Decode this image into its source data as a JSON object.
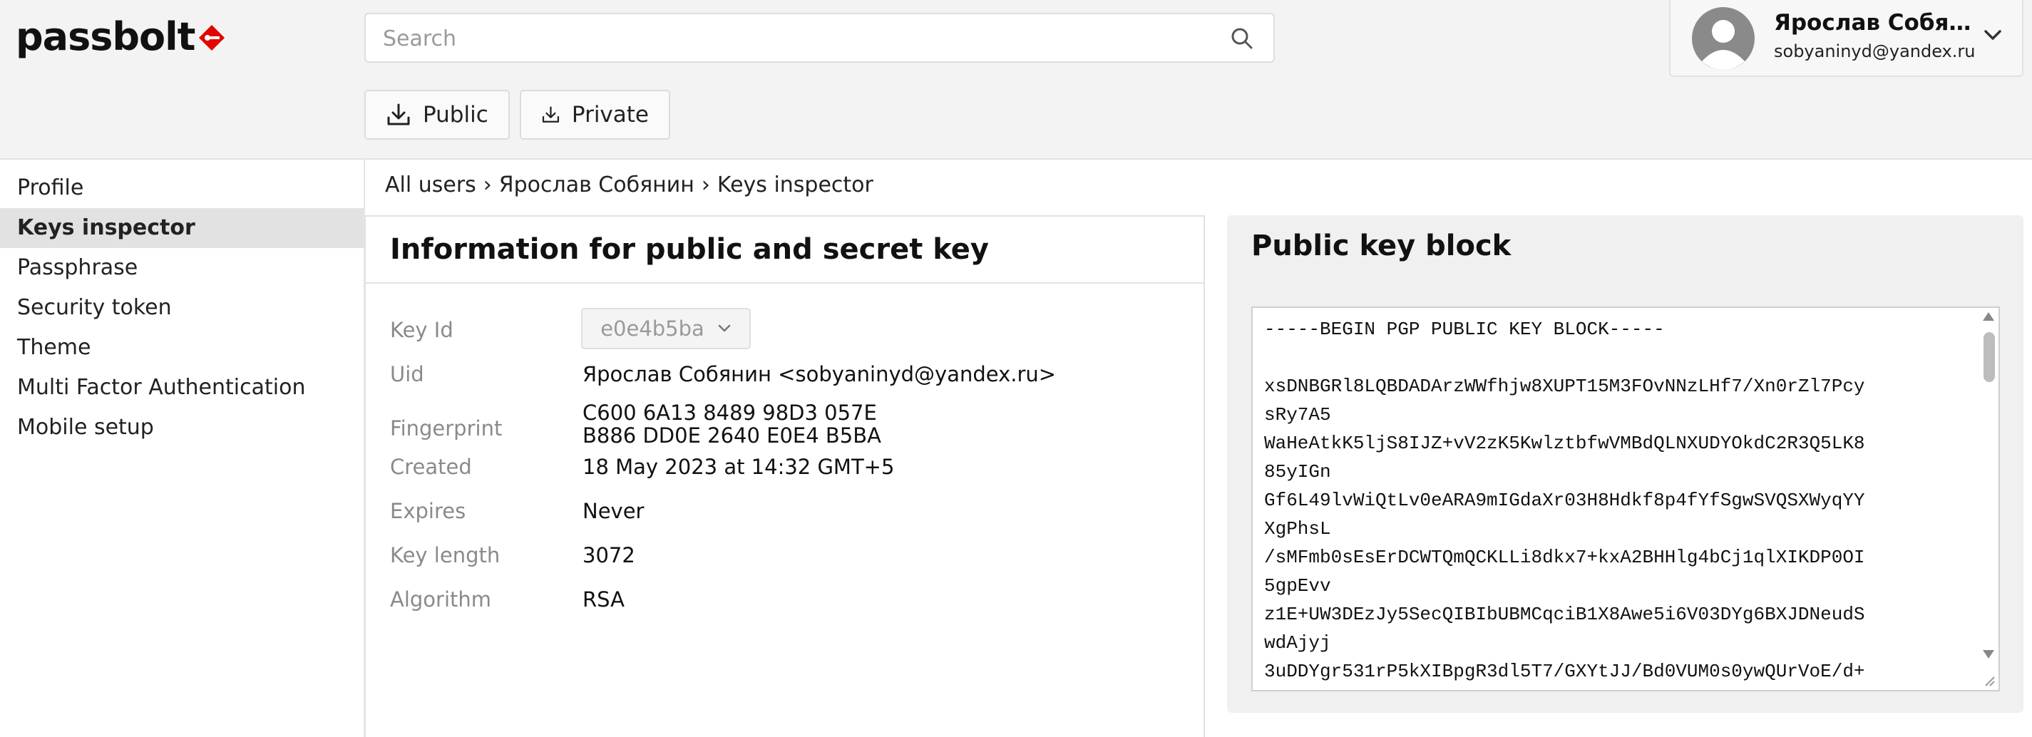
{
  "app": {
    "logo_text": "passbolt"
  },
  "search": {
    "placeholder": "Search",
    "value": ""
  },
  "user": {
    "name": "Ярослав Собян...",
    "email": "sobyaninyd@yandex.ru"
  },
  "actions": {
    "public_label": "Public",
    "private_label": "Private"
  },
  "sidebar": {
    "items": [
      {
        "label": "Profile",
        "active": false
      },
      {
        "label": "Keys inspector",
        "active": true
      },
      {
        "label": "Passphrase",
        "active": false
      },
      {
        "label": "Security token",
        "active": false
      },
      {
        "label": "Theme",
        "active": false
      },
      {
        "label": "Multi Factor Authentication",
        "active": false
      },
      {
        "label": "Mobile setup",
        "active": false
      }
    ]
  },
  "breadcrumb": {
    "items": [
      "All users",
      "Ярослав Собянин",
      "Keys inspector"
    ],
    "separator": "›"
  },
  "info": {
    "title": "Information for public and secret key",
    "key_id_label": "Key Id",
    "key_id_value": "e0e4b5ba",
    "uid_label": "Uid",
    "uid_value": "Ярослав Собянин <sobyaninyd@yandex.ru>",
    "fingerprint_label": "Fingerprint",
    "fingerprint_line1": "C600 6A13 8489 98D3 057E",
    "fingerprint_line2": "B886 DD0E 2640 E0E4 B5BA",
    "created_label": "Created",
    "created_value": "18 May 2023 at 14:32 GMT+5",
    "expires_label": "Expires",
    "expires_value": "Never",
    "key_length_label": "Key length",
    "key_length_value": "3072",
    "algorithm_label": "Algorithm",
    "algorithm_value": "RSA"
  },
  "public_key": {
    "title": "Public key block",
    "text": "-----BEGIN PGP PUBLIC KEY BLOCK-----\n\nxsDNBGRl8LQBDADArzWWfhjw8XUPT15M3FOvNNzLHf7/Xn0rZl7Pcy\nsRy7A5\nWaHeAtkK5ljS8IJZ+vV2zK5KwlztbfwVMBdQLNXUDYOkdC2R3Q5LK8\n85yIGn\nGf6L49lvWiQtLv0eARA9mIGdaXr03H8Hdkf8p4fYfSgwSVQSXWyqYY\nXgPhsL\n/sMFmb0sEsErDCWTQmQCKLLi8dkx7+kxA2BHHlg4bCj1qlXIKDP0OI\n5gpEvv\nz1E+UW3DEzJy5SecQIBIbUBMCqciB1X8Awe5i6V03DYg6BXJDNeudS\nwdAjyj\n3uDDYgr531rP5kXIBpgR3dl5T7/GXYtJJ/Bd0VUM0s0ywQUrVoE/d+"
  },
  "colors": {
    "accent": "#e10600",
    "active_bg": "#e2e2e2",
    "header_bg": "#f3f3f3"
  }
}
